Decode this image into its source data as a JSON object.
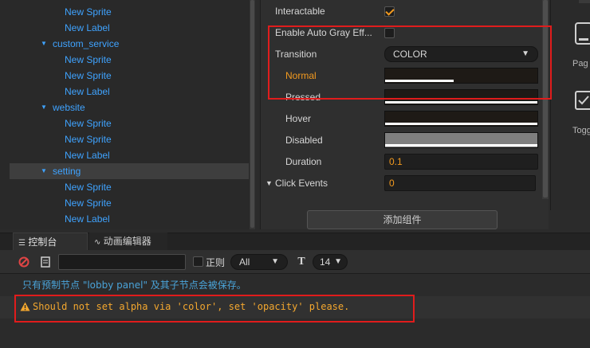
{
  "tree": {
    "items": [
      {
        "label": "New Sprite",
        "indent": 2,
        "arrow": false
      },
      {
        "label": "New Label",
        "indent": 2,
        "arrow": false
      },
      {
        "label": "custom_service",
        "indent": 1,
        "arrow": true
      },
      {
        "label": "New Sprite",
        "indent": 2,
        "arrow": false
      },
      {
        "label": "New Sprite",
        "indent": 2,
        "arrow": false
      },
      {
        "label": "New Label",
        "indent": 2,
        "arrow": false
      },
      {
        "label": "website",
        "indent": 1,
        "arrow": true
      },
      {
        "label": "New Sprite",
        "indent": 2,
        "arrow": false
      },
      {
        "label": "New Sprite",
        "indent": 2,
        "arrow": false
      },
      {
        "label": "New Label",
        "indent": 2,
        "arrow": false
      },
      {
        "label": "setting",
        "indent": 1,
        "arrow": true,
        "selected": true
      },
      {
        "label": "New Sprite",
        "indent": 2,
        "arrow": false
      },
      {
        "label": "New Sprite",
        "indent": 2,
        "arrow": false
      },
      {
        "label": "New Label",
        "indent": 2,
        "arrow": false
      }
    ],
    "arrow_glyph": "▼"
  },
  "inspector": {
    "interactable_label": "Interactable",
    "auto_gray_label": "Enable Auto Gray Eff...",
    "transition_label": "Transition",
    "transition_value": "COLOR",
    "transition_caret": "▼",
    "normal_label": "Normal",
    "pressed_label": "Pressed",
    "hover_label": "Hover",
    "disabled_label": "Disabled",
    "duration_label": "Duration",
    "duration_value": "0.1",
    "click_events_label": "Click Events",
    "click_events_arrow": "▼",
    "click_events_value": "0",
    "add_component_label": "添加组件",
    "interactable_checked": true,
    "auto_gray_checked": false,
    "colors": {
      "normal": "#1e1a16",
      "pressed": "#1e1a16",
      "hover": "#1e1a16",
      "disabled": "#7f7f7f",
      "accent": "#f39a1f"
    },
    "normal_alpha_fraction": 0.45
  },
  "library": {
    "page_label": "Pag",
    "toggle_label": "Togg"
  },
  "console": {
    "tab_console": "控制台",
    "tab_animation": "动画编辑器",
    "regex_label": "正则",
    "level_value": "All",
    "level_caret": "▼",
    "font_size_value": "14",
    "font_size_caret": "▼",
    "search_value": "",
    "search_placeholder": "",
    "info_message": "只有预制节点 \"lobby panel\" 及其子节点会被保存。",
    "warning_message": "Should not set alpha via 'color', set 'opacity' please.",
    "warning_color": "#f3a72e",
    "info_color": "#4aa3d8"
  }
}
